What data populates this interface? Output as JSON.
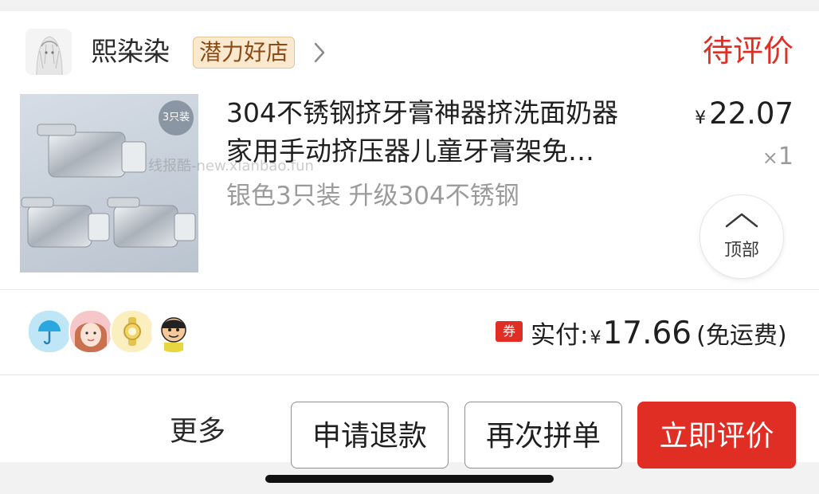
{
  "shop": {
    "name": "熙染染",
    "badge": "潜力好店",
    "status": "待评价"
  },
  "product": {
    "title_line1": "304不锈钢挤牙膏神器挤洗面奶器",
    "title_line2": "家用手动挤压器儿童牙膏架免…",
    "spec": "银色3只装 升级304不锈钢",
    "price_symbol": "¥",
    "price": "22.07",
    "qty_symbol": "×",
    "qty": "1",
    "image_badge": "3只装"
  },
  "watermark": "线报酷-new.xianbao.fun",
  "back_to_top": "顶部",
  "buyers": [
    "umbrella-avatar",
    "girl-avatar",
    "watch-avatar",
    "cartoon-avatar"
  ],
  "payment": {
    "coupon_tag": "券",
    "label": "实付:",
    "symbol": "¥",
    "amount": "17.66",
    "note": "(免运费)"
  },
  "actions": {
    "more": "更多",
    "refund": "申请退款",
    "regroup": "再次拼单",
    "review": "立即评价"
  },
  "colors": {
    "accent": "#e02e24",
    "badge_bg": "#fbe9cf",
    "badge_text": "#8a4b16"
  }
}
